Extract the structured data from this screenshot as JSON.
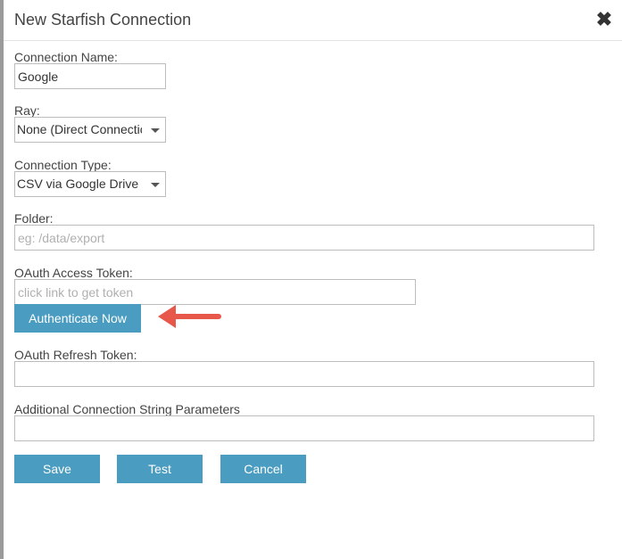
{
  "dialog": {
    "title": "New Starfish Connection",
    "close_symbol": "✖"
  },
  "fields": {
    "connection_name": {
      "label": "Connection Name:",
      "value": "Google"
    },
    "ray": {
      "label": "Ray:",
      "selected": "None (Direct Connection)"
    },
    "connection_type": {
      "label": "Connection Type:",
      "selected": "CSV via Google Drive"
    },
    "folder": {
      "label": "Folder:",
      "value": "",
      "placeholder": "eg: /data/export"
    },
    "oauth_access_token": {
      "label": "OAuth Access Token:",
      "value": "",
      "placeholder": "click link to get token"
    },
    "oauth_refresh_token": {
      "label": "OAuth Refresh Token:",
      "value": ""
    },
    "additional_params": {
      "label": "Additional Connection String Parameters",
      "value": ""
    }
  },
  "buttons": {
    "authenticate": "Authenticate Now",
    "save": "Save",
    "test": "Test",
    "cancel": "Cancel"
  },
  "colors": {
    "button_bg": "#4a9cc0",
    "arrow": "#e8584a"
  },
  "icons": {
    "close": "close-icon",
    "caret": "chevron-down-icon",
    "annotation_arrow": "arrow-left-icon"
  }
}
